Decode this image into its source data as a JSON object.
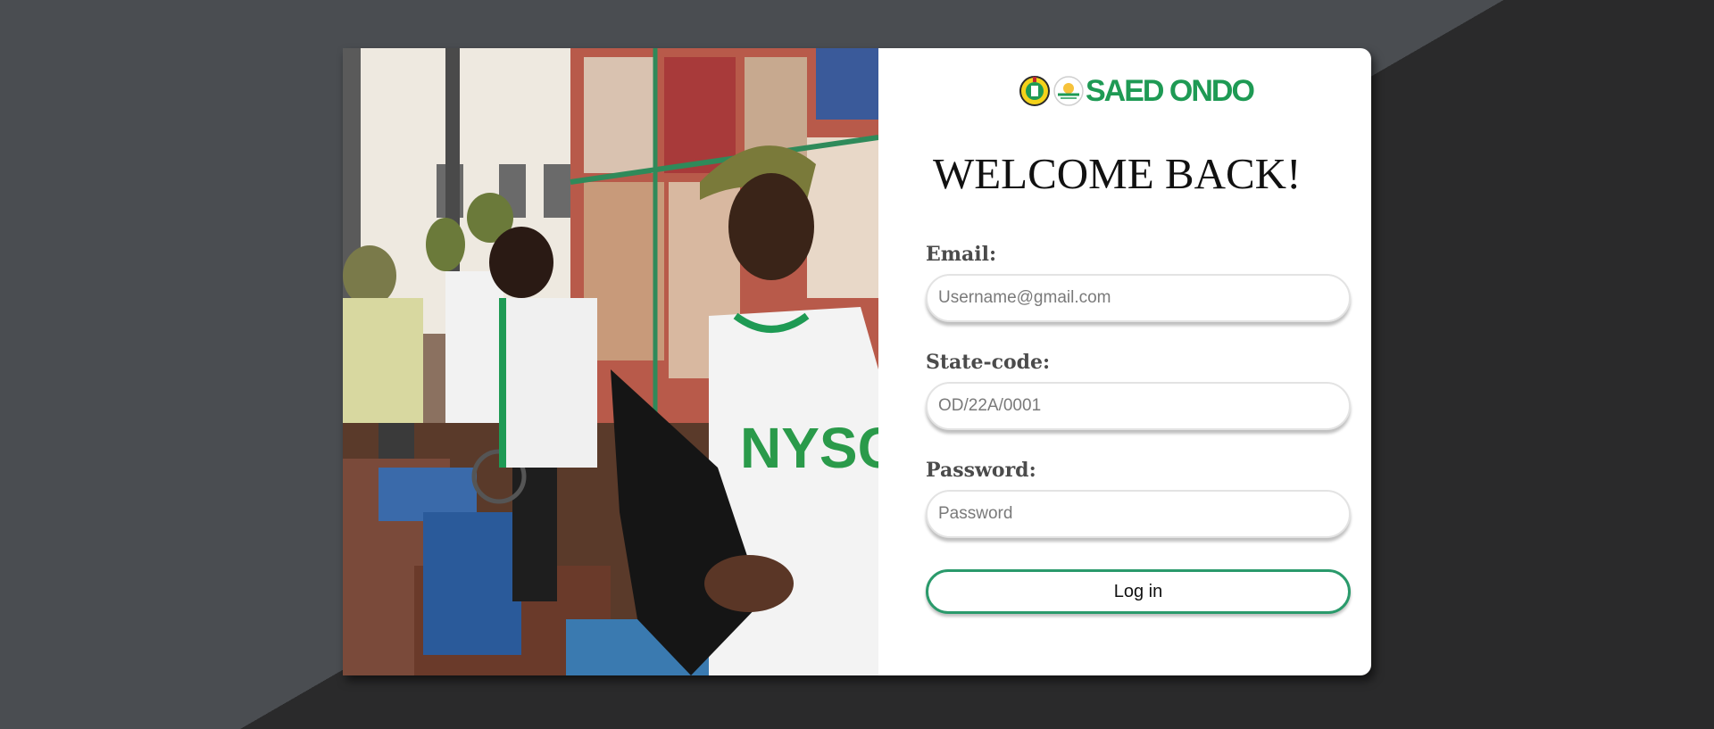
{
  "brand": {
    "logo_text": "SAED ONDO",
    "accent_color": "#1e9a54",
    "icons": [
      "nysc-crest-icon",
      "nysc-saed-emblem-icon"
    ]
  },
  "hero_image": {
    "subject": "NYSC corps members operating sewing machines"
  },
  "form": {
    "title": "WELCOME BACK!",
    "email": {
      "label": "Email:",
      "placeholder": "Username@gmail.com"
    },
    "state_code": {
      "label": "State-code:",
      "placeholder": "OD/22A/0001"
    },
    "password": {
      "label": "Password:",
      "placeholder": "Password"
    },
    "submit_label": "Log in",
    "button_border_color": "#2a9a6b"
  }
}
